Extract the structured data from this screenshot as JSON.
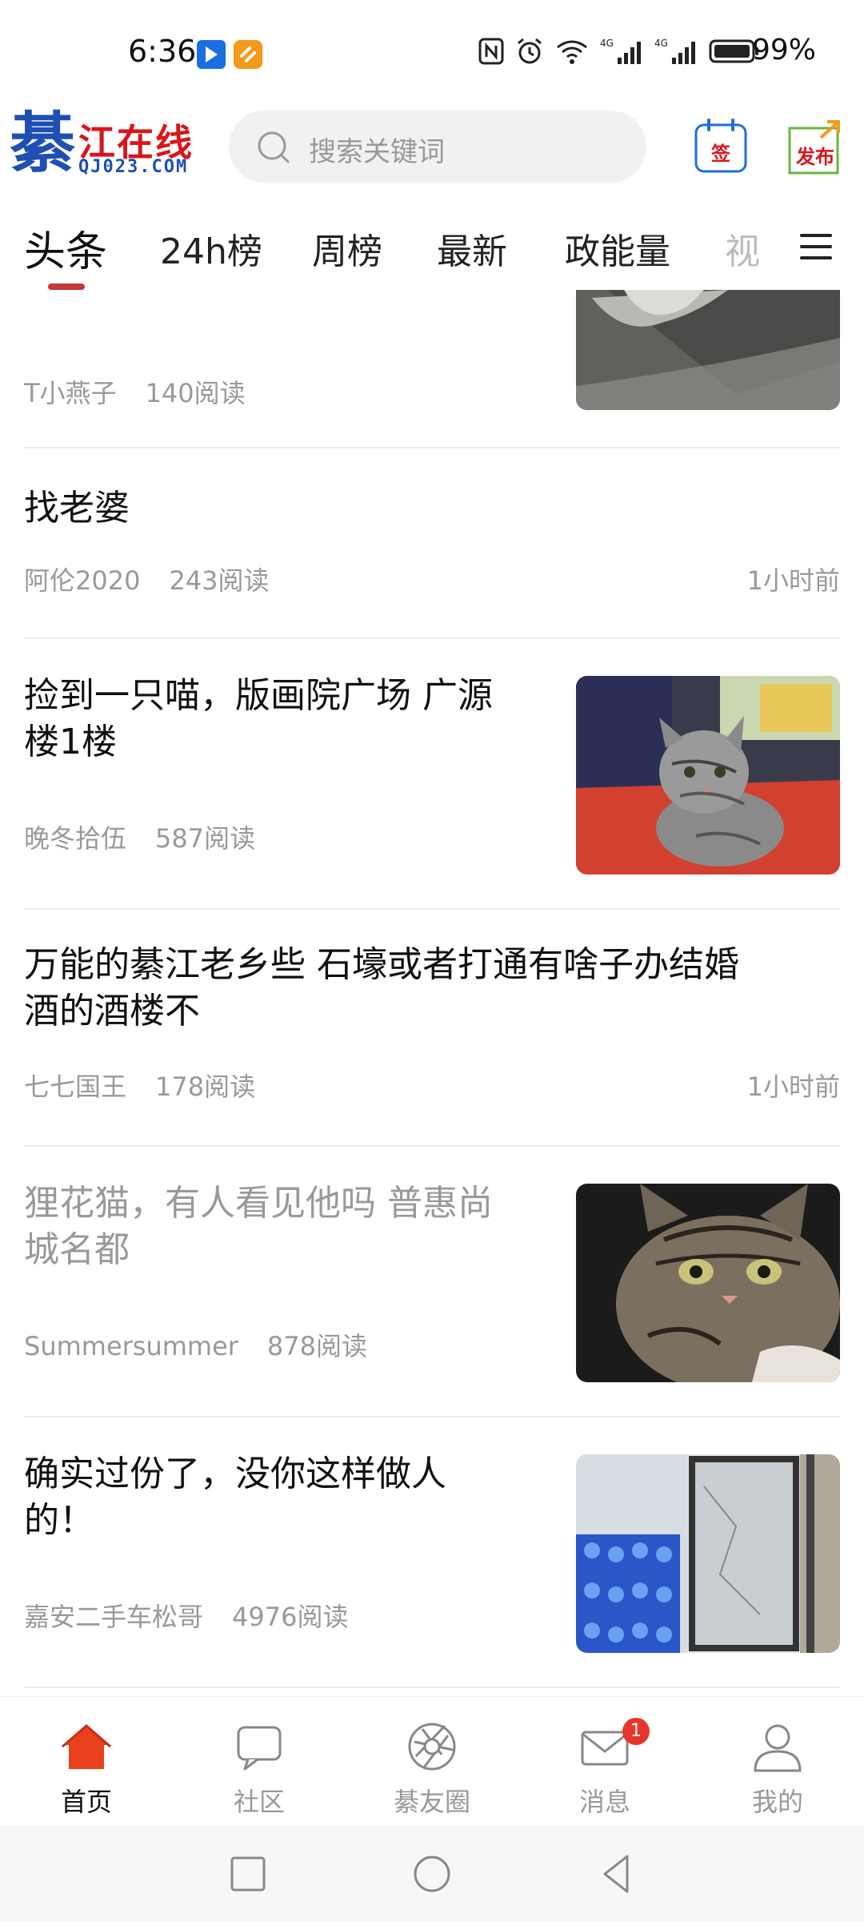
{
  "status_bar": {
    "time": "6:36",
    "battery": "99%",
    "network_label_1": "4G",
    "network_label_2": "4G"
  },
  "header": {
    "logo_char": "綦",
    "logo_cn": "江在线",
    "logo_en": "QJ023.COM",
    "search_placeholder": "搜索关键词",
    "sign_label": "签",
    "publish_label": "发布"
  },
  "tabs": [
    {
      "label": "头条",
      "active": true
    },
    {
      "label": "24h榜"
    },
    {
      "label": "周榜"
    },
    {
      "label": "最新"
    },
    {
      "label": "政能量"
    },
    {
      "label": "视"
    }
  ],
  "feed": [
    {
      "author": "T小燕子",
      "reads": "140阅读",
      "image": "cat-partial"
    },
    {
      "title": "找老婆",
      "author": "阿伦2020",
      "reads": "243阅读",
      "time": "1小时前"
    },
    {
      "title_line1": "捡到一只喵，版画院广场 广源",
      "title_line2": "楼1楼",
      "author": "晚冬拾伍",
      "reads": "587阅读",
      "image": "grey-cat-on-red-mat"
    },
    {
      "title_line1": "万能的綦江老乡些 石壕或者打通有啥子办结婚",
      "title_line2": "酒的酒楼不",
      "author": "七七国王",
      "reads": "178阅读",
      "time": "1小时前"
    },
    {
      "title_line1": "狸花猫，有人看见他吗 普惠尚",
      "title_line2": "城名都",
      "author": "Summersummer",
      "reads": "878阅读",
      "image": "tabby-cat",
      "read": true
    },
    {
      "title_line1": "确实过份了，没你这样做人",
      "title_line2": "的！",
      "author": "嘉安二手车松哥",
      "reads": "4976阅读",
      "image": "broken-fridge"
    }
  ],
  "bottom_nav": [
    {
      "label": "首页",
      "icon": "home-icon",
      "active": true
    },
    {
      "label": "社区",
      "icon": "chat-icon"
    },
    {
      "label": "綦友圈",
      "icon": "aperture-icon"
    },
    {
      "label": "消息",
      "icon": "mail-icon",
      "badge": "1"
    },
    {
      "label": "我的",
      "icon": "user-icon"
    }
  ],
  "colors": {
    "accent": "#c23b3b",
    "home_icon": "#e8401c",
    "logo_red": "#d8161b",
    "logo_blue": "#1f4fb3"
  }
}
